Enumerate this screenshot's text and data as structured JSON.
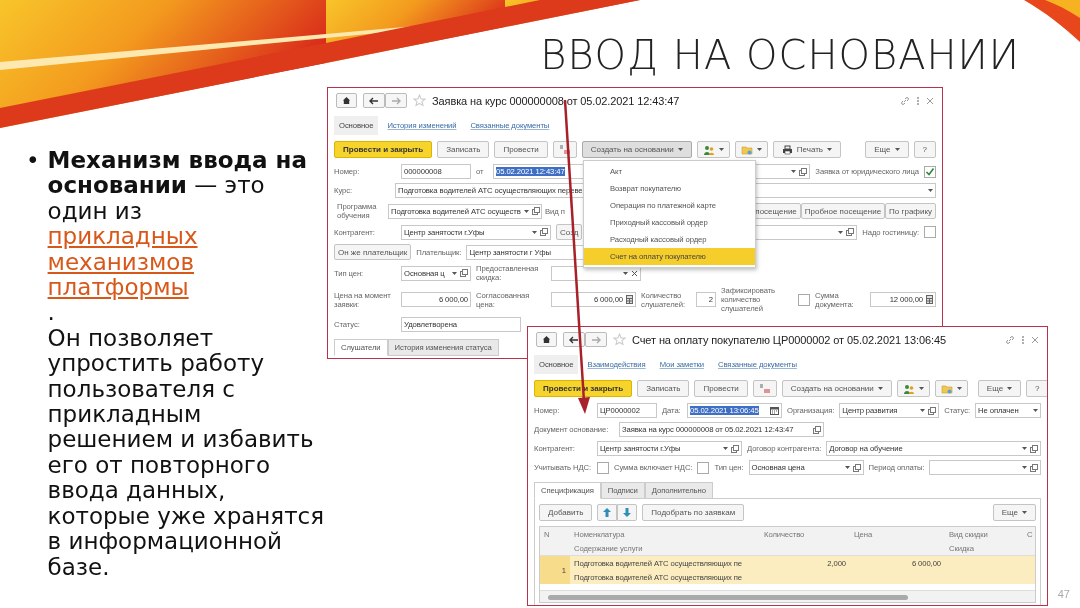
{
  "slide": {
    "title": "ВВОД НА ОСНОВАНИИ",
    "number": "47"
  },
  "bullet": {
    "marker": "•",
    "lead": "**Механизм ввода на основании** — это один из ",
    "link": "прикладных механизмов платформы",
    "after": ".",
    "text": "Он позволяет упростить работу пользователя с прикладным решением и избавить его от повторного ввода данных, которые уже хранятся в информационной базе."
  },
  "windows": [
    {
      "title": "Заявка на курс 000000008 от 05.02.2021 12:43:47",
      "tabs": [
        {
          "label": "Основное",
          "selected": true
        },
        {
          "label": "История изменений",
          "selected": false
        },
        {
          "label": "Связанные документы",
          "selected": false
        }
      ],
      "toolbar": [
        {
          "kind": "primary",
          "label": "Провести и закрыть"
        },
        {
          "kind": "button",
          "label": "Записать"
        },
        {
          "kind": "button",
          "label": "Провести"
        },
        {
          "kind": "dtkt"
        },
        {
          "kind": "menu",
          "label": "Создать на основании",
          "open": true
        },
        {
          "kind": "structure"
        },
        {
          "kind": "files"
        },
        {
          "kind": "print",
          "label": "Печать"
        }
      ],
      "toolbar_right": [
        {
          "kind": "menu",
          "label": "Еще",
          "open": false
        },
        {
          "kind": "button",
          "label": "?"
        }
      ],
      "menu": [
        {
          "label": "Акт",
          "selected": false
        },
        {
          "label": "Возврат покупателю",
          "selected": false
        },
        {
          "label": "Операция по платежной карте",
          "selected": false
        },
        {
          "label": "Приходный кассовый ордер",
          "selected": false
        },
        {
          "label": "Расходный кассовый ордер",
          "selected": false
        },
        {
          "label": "Счет на оплату покупателю",
          "selected": true
        }
      ],
      "form": [
        {
          "items": [
            {
              "kind": "label",
              "text": "Номер:"
            },
            {
              "kind": "field",
              "value": "000000008"
            },
            {
              "kind": "label",
              "text": "от"
            },
            {
              "kind": "field",
              "value": "05.02.2021 12:43:47",
              "highlighted": true
            },
            {
              "kind": "field",
              "buttons": [
                {
                  "kind": "dropdown"
                },
                {
                  "kind": "open"
                }
              ]
            },
            {
              "kind": "label",
              "text": "Заявка от юридического лица"
            },
            {
              "kind": "check",
              "checked": true
            }
          ]
        },
        {
          "items": [
            {
              "kind": "label",
              "text": "Курс:"
            },
            {
              "kind": "field",
              "value": "Подготовка водителей АТС осуществляющих переве",
              "buttons": [
                {
                  "kind": "dropdown"
                }
              ]
            }
          ]
        },
        {
          "items": [
            {
              "kind": "label",
              "text": "Программа обучения"
            },
            {
              "kind": "field",
              "value": "Подготовка водителей АТС осуществ",
              "buttons": [
                {
                  "kind": "dropdown"
                },
                {
                  "kind": "open"
                }
              ]
            },
            {
              "kind": "label",
              "text": "Вид п"
            },
            {
              "kind": "button",
              "label": "посещение"
            },
            {
              "kind": "button",
              "label": "Пробное посещение"
            },
            {
              "kind": "button",
              "label": "По графику"
            }
          ]
        },
        {
          "items": [
            {
              "kind": "label",
              "text": "Контрагент:"
            },
            {
              "kind": "field",
              "value": "Центр занятости г.Уфы",
              "buttons": [
                {
                  "kind": "dropdown"
                },
                {
                  "kind": "open"
                }
              ]
            },
            {
              "kind": "button",
              "label": "Созд"
            },
            {
              "kind": "field",
              "buttons": [
                {
                  "kind": "dropdown"
                },
                {
                  "kind": "open"
                }
              ]
            },
            {
              "kind": "label",
              "text": "Надо гостиницу:"
            },
            {
              "kind": "check",
              "checked": false
            }
          ]
        },
        {
          "items": [
            {
              "kind": "button",
              "label": "Он же плательщик"
            },
            {
              "kind": "label",
              "text": "Плательщик:"
            },
            {
              "kind": "field",
              "value": "Центр занятости г Уфы"
            }
          ]
        },
        {
          "items": [
            {
              "kind": "label",
              "text": "Тип цен:"
            },
            {
              "kind": "field",
              "value": "Основная ц",
              "buttons": [
                {
                  "kind": "dropdown"
                },
                {
                  "kind": "open"
                }
              ]
            },
            {
              "kind": "label",
              "text": "Предоставленная скидка:"
            },
            {
              "kind": "field",
              "buttons": [
                {
                  "kind": "dropdown"
                },
                {
                  "kind": "clear"
                }
              ]
            }
          ]
        },
        {
          "items": [
            {
              "kind": "label",
              "text": "Цена на момент заявки:"
            },
            {
              "kind": "number",
              "value": "6 000,00"
            },
            {
              "kind": "label",
              "text": "Согласованная цена:"
            },
            {
              "kind": "number",
              "value": "6 000,00",
              "buttons": [
                {
                  "kind": "calc"
                }
              ]
            },
            {
              "kind": "label",
              "text": "Количество слушателей:"
            },
            {
              "kind": "number",
              "value": "2"
            },
            {
              "kind": "label",
              "text": "Зафиксировать количество слушателей"
            },
            {
              "kind": "check",
              "checked": false
            },
            {
              "kind": "label",
              "text": "Сумма документа:"
            },
            {
              "kind": "number",
              "value": "12 000,00",
              "buttons": [
                {
                  "kind": "calc"
                }
              ]
            }
          ]
        },
        {
          "items": [
            {
              "kind": "label",
              "text": "Статус:"
            },
            {
              "kind": "field",
              "value": "Удовлетворена"
            }
          ]
        }
      ],
      "bottom_tabs": [
        {
          "label": "Слушатели",
          "selected": true
        },
        {
          "label": "История изменения статуса",
          "selected": false
        }
      ]
    },
    {
      "title": "Счет на оплату покупателю ЦР0000002 от 05.02.2021 13:06:45",
      "tabs": [
        {
          "label": "Основное",
          "selected": true
        },
        {
          "label": "Взаимодействия",
          "selected": false
        },
        {
          "label": "Мои заметки",
          "selected": false
        },
        {
          "label": "Связанные документы",
          "selected": false
        }
      ],
      "toolbar": [
        {
          "kind": "primary",
          "label": "Провести и закрыть"
        },
        {
          "kind": "button",
          "label": "Записать"
        },
        {
          "kind": "button",
          "label": "Провести"
        },
        {
          "kind": "dtkt"
        },
        {
          "kind": "menu",
          "label": "Создать на основании",
          "open": false
        },
        {
          "kind": "structure"
        },
        {
          "kind": "files"
        }
      ],
      "toolbar_right": [
        {
          "kind": "menu",
          "label": "Еще",
          "open": false
        },
        {
          "kind": "button",
          "label": "?"
        }
      ],
      "form": [
        {
          "items": [
            {
              "kind": "label",
              "text": "Номер:"
            },
            {
              "kind": "field",
              "value": "ЦР0000002"
            },
            {
              "kind": "label",
              "text": "Дата:"
            },
            {
              "kind": "field",
              "value": "05.02.2021 13:06:45",
              "highlighted": true,
              "buttons": [
                {
                  "kind": "calendar"
                }
              ]
            },
            {
              "kind": "label",
              "text": "Организация:"
            },
            {
              "kind": "field",
              "value": "Центр развития",
              "buttons": [
                {
                  "kind": "dropdown"
                },
                {
                  "kind": "open"
                }
              ]
            },
            {
              "kind": "label",
              "text": "Статус:"
            },
            {
              "kind": "field",
              "value": "Не оплачен",
              "buttons": [
                {
                  "kind": "dropdown"
                }
              ]
            }
          ]
        },
        {
          "items": [
            {
              "kind": "label",
              "text": "Документ основание:"
            },
            {
              "kind": "field",
              "value": "Заявка на курс 000000008 от 05.02.2021 12:43:47",
              "buttons": [
                {
                  "kind": "open"
                }
              ]
            }
          ]
        },
        {
          "items": [
            {
              "kind": "label",
              "text": "Контрагент:"
            },
            {
              "kind": "field",
              "value": "Центр занятости г.Уфы",
              "buttons": [
                {
                  "kind": "dropdown"
                },
                {
                  "kind": "open"
                }
              ]
            },
            {
              "kind": "label",
              "text": "Договор контрагента:"
            },
            {
              "kind": "field",
              "value": "Договор на обучение",
              "buttons": [
                {
                  "kind": "dropdown"
                },
                {
                  "kind": "open"
                }
              ]
            }
          ]
        },
        {
          "items": [
            {
              "kind": "label",
              "text": "Учитывать НДС:"
            },
            {
              "kind": "check",
              "checked": false
            },
            {
              "kind": "label",
              "text": "Сумма включает НДС:"
            },
            {
              "kind": "check",
              "checked": false
            },
            {
              "kind": "label",
              "text": "Тип цен:"
            },
            {
              "kind": "field",
              "value": "Основная цена",
              "buttons": [
                {
                  "kind": "dropdown"
                },
                {
                  "kind": "open"
                }
              ]
            },
            {
              "kind": "label",
              "text": "Период оплаты:"
            },
            {
              "kind": "field",
              "buttons": [
                {
                  "kind": "dropdown"
                },
                {
                  "kind": "open"
                }
              ]
            }
          ]
        }
      ],
      "inner_tabs": [
        {
          "label": "Спецификация",
          "selected": true
        },
        {
          "label": "Подписи",
          "selected": false
        },
        {
          "label": "Дополнительно",
          "selected": false
        }
      ],
      "table_toolbar": [
        {
          "kind": "button",
          "label": "Добавить"
        },
        {
          "kind": "up"
        },
        {
          "kind": "down"
        },
        {
          "kind": "button",
          "label": "Подобрать по заявкам"
        }
      ],
      "table_toolbar_right": [
        {
          "kind": "menu",
          "label": "Еще",
          "open": false
        }
      ],
      "table": {
        "columns": [
          {
            "label": "N"
          },
          {
            "label": "Номенклатура",
            "sub": "Содержание услуги"
          },
          {
            "label": "Количество"
          },
          {
            "label": "Цена"
          },
          {
            "label": "Вид скидки",
            "sub": "Скидка"
          },
          {
            "label": "С"
          }
        ],
        "rows": [
          {
            "selected": true,
            "cells": [
              "1",
              "Подготовка водителей АТС осуществляющих пе",
              "2,000",
              "6 000,00"
            ],
            "sub": "Подготовка водителей АТС осуществляющих пе"
          }
        ]
      }
    }
  ]
}
